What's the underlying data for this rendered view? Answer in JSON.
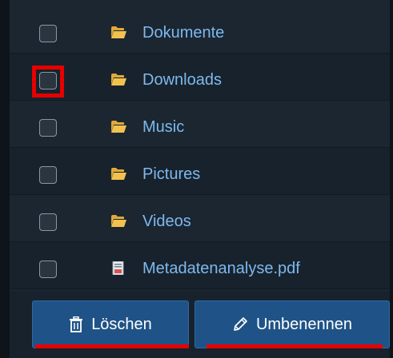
{
  "files": [
    {
      "name": "Dokumente",
      "type": "folder",
      "checked": false,
      "icon": "folder-icon"
    },
    {
      "name": "Downloads",
      "type": "folder",
      "checked": false,
      "icon": "folder-icon",
      "highlighted": true
    },
    {
      "name": "Music",
      "type": "folder",
      "checked": false,
      "icon": "folder-icon"
    },
    {
      "name": "Pictures",
      "type": "folder",
      "checked": false,
      "icon": "folder-icon"
    },
    {
      "name": "Videos",
      "type": "folder",
      "checked": false,
      "icon": "folder-icon"
    },
    {
      "name": "Metadatenanalyse.pdf",
      "type": "file",
      "checked": false,
      "icon": "pdf-file-icon"
    }
  ],
  "toolbar": {
    "delete_label": "Löschen",
    "delete_icon": "trash-icon",
    "rename_label": "Umbenennen",
    "rename_icon": "pencil-icon"
  },
  "colors": {
    "background": "#1b2631",
    "link": "#7db9ef",
    "button": "#1f5387",
    "annotation": "#e60000",
    "folder": "#f2c24f"
  }
}
